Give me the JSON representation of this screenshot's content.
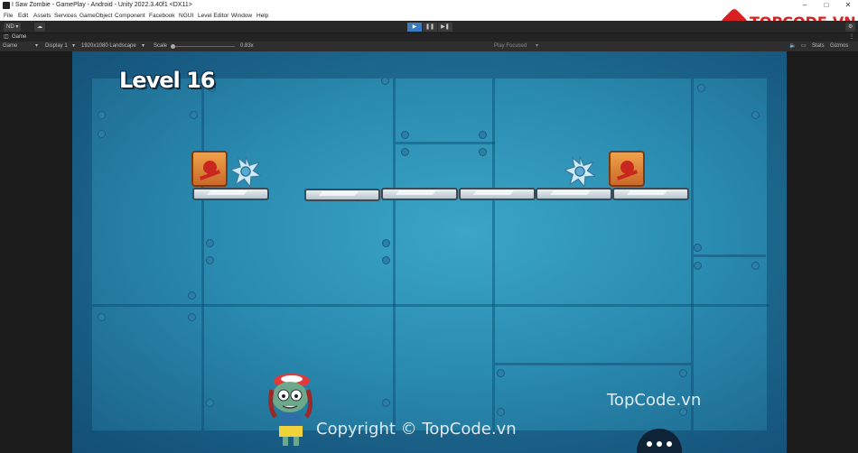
{
  "window": {
    "title": "I Saw Zombie - GamePlay - Android - Unity 2022.3.40f1 <DX11>"
  },
  "menu": [
    "File",
    "Edit",
    "Assets",
    "Services",
    "GameObject",
    "Component",
    "Facebook",
    "NGUI",
    "Level Editor",
    "Window",
    "Help"
  ],
  "toolbar": {
    "account": "ND",
    "play_icon": "play-icon",
    "pause_icon": "pause-icon",
    "step_icon": "step-icon"
  },
  "tab": {
    "label": "Game"
  },
  "gamebar": {
    "view": "Game",
    "display": "Display 1",
    "resolution": "1920x1080 Landscape",
    "scale_label": "Scale",
    "scale_value": "0.83x",
    "play_mode": "Play Focused",
    "stats": "Stats",
    "gizmos": "Gizmos"
  },
  "game": {
    "level": "Level 16",
    "watermark_1": "TopCode.vn",
    "watermark_2": "Copyright © TopCode.vn"
  },
  "logo": {
    "text": "TOPCODE.VN"
  },
  "colors": {
    "accent": "#3a79bb",
    "logo": "#d7201f",
    "wall": "#2a8bb0"
  }
}
